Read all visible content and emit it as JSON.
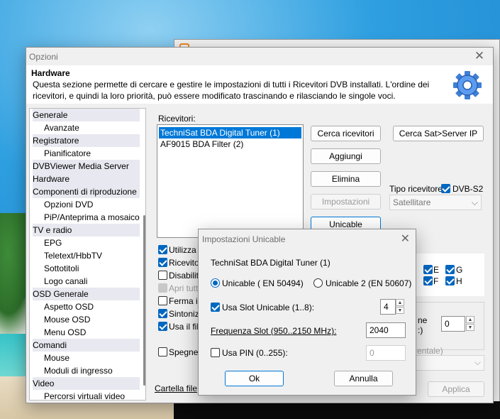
{
  "options_window": {
    "title": "Opzioni",
    "close_glyph": "✕",
    "header": {
      "title": "Hardware",
      "description": "Questa sezione permette di cercare e gestire le impostazioni di tutti i Ricevitori DVB installati. L'ordine dei ricevitori, e quindi la loro priorità, può essere modificato trascinando e rilasciando le singole voci.",
      "icon": "gear-icon"
    },
    "tree": [
      {
        "label": "Generale",
        "kind": "cat"
      },
      {
        "label": "Avanzate",
        "kind": "sub"
      },
      {
        "label": "Registratore",
        "kind": "cat"
      },
      {
        "label": "Pianificatore",
        "kind": "sub"
      },
      {
        "label": "DVBViewer Media Server",
        "kind": "cat"
      },
      {
        "label": "Hardware",
        "kind": "cat"
      },
      {
        "label": "Componenti di riproduzione",
        "kind": "cat"
      },
      {
        "label": "Opzioni DVD",
        "kind": "sub"
      },
      {
        "label": "PiP/Anteprima a mosaico",
        "kind": "sub"
      },
      {
        "label": "TV e radio",
        "kind": "cat"
      },
      {
        "label": "EPG",
        "kind": "sub"
      },
      {
        "label": "Teletext/HbbTV",
        "kind": "sub"
      },
      {
        "label": "Sottotitoli",
        "kind": "sub"
      },
      {
        "label": "Logo canali",
        "kind": "sub"
      },
      {
        "label": "OSD Generale",
        "kind": "cat"
      },
      {
        "label": "Aspetto OSD",
        "kind": "sub"
      },
      {
        "label": "Mouse OSD",
        "kind": "sub"
      },
      {
        "label": "Menu OSD",
        "kind": "sub"
      },
      {
        "label": "Comandi",
        "kind": "cat"
      },
      {
        "label": "Mouse",
        "kind": "sub"
      },
      {
        "label": "Moduli di ingresso",
        "kind": "sub"
      },
      {
        "label": "Video",
        "kind": "cat"
      },
      {
        "label": "Percorsi virtuali video",
        "kind": "sub"
      }
    ],
    "receivers_label": "Ricevitori:",
    "receivers": [
      {
        "label": "TechniSat BDA Digital Tuner (1)",
        "selected": true
      },
      {
        "label": "AF9015 BDA Filter (2)",
        "selected": false
      }
    ],
    "buttons": {
      "cerca": "Cerca ricevitori",
      "cerca_sat": "Cerca Sat>Server IP",
      "aggiungi": "Aggiungi",
      "elimina": "Elimina",
      "impostazioni": "Impostazioni",
      "unicable": "Unicable",
      "applica": "Applica"
    },
    "tipo_label": "Tipo ricevitore",
    "dvbs2_label": "DVB-S2",
    "tipo_value": "Satellitare",
    "checkboxes": [
      {
        "label": "Utilizza r",
        "checked": true,
        "disabled": false
      },
      {
        "label": "Ricevitor",
        "checked": true,
        "disabled": false
      },
      {
        "label": "Disabilit",
        "checked": false,
        "disabled": false
      },
      {
        "label": "Apri tutt",
        "checked": true,
        "disabled": true
      },
      {
        "label": "Ferma il",
        "checked": false,
        "disabled": false
      },
      {
        "label": "Sintonizz",
        "checked": true,
        "disabled": false
      },
      {
        "label": "Usa il filt",
        "checked": true,
        "disabled": false
      }
    ],
    "spegne_label": "Spegne",
    "cartella_label": "Cartella file",
    "dvb_letters": [
      "E",
      "G",
      "F",
      "H"
    ],
    "right_partial_1": "ne",
    "right_partial_2": ":)",
    "spin_value": "0",
    "mentale_partial": "entale)"
  },
  "unicable_dialog": {
    "title": "Impostazioni Unicable",
    "close_glyph": "✕",
    "device": "TechniSat BDA Digital Tuner (1)",
    "radio1": "Unicable ( EN 50494)",
    "radio2": "Unicable 2 (EN 50607)",
    "slot_label": "Usa Slot Unicable (1..8):",
    "slot_value": "4",
    "freq_label": "Frequenza Slot (950..2150 MHz):",
    "freq_value": "2040",
    "pin_label": "Usa PIN (0..255):",
    "pin_value": "0",
    "ok": "Ok",
    "annulla": "Annulla"
  }
}
